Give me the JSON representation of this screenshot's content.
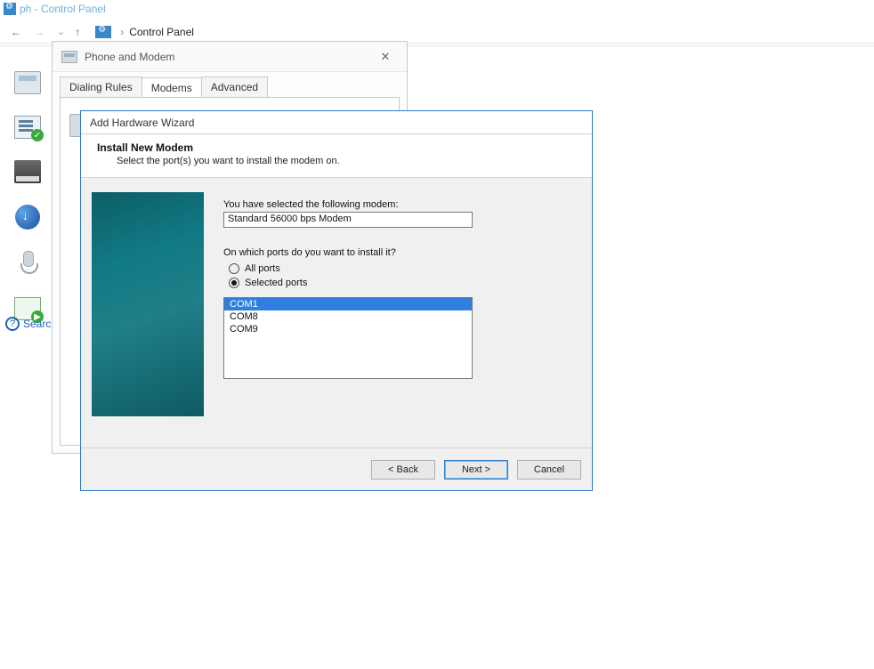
{
  "window": {
    "title": "ph - Control Panel"
  },
  "nav": {
    "breadcrumb": "Control Panel"
  },
  "search": {
    "label": "Searc"
  },
  "phone_dialog": {
    "title": "Phone and Modem",
    "tabs": [
      "Dialing Rules",
      "Modems",
      "Advanced"
    ],
    "active_tab": 1
  },
  "wizard": {
    "title": "Add Hardware Wizard",
    "heading": "Install New Modem",
    "subheading": "Select the port(s) you want to install the modem on.",
    "selected_label": "You have selected the following modem:",
    "selected_modem": "Standard 56000 bps Modem",
    "port_question": "On which ports do you want to install it?",
    "radio_all": "All ports",
    "radio_selected": "Selected ports",
    "radio_choice": "selected",
    "ports": [
      "COM1",
      "COM8",
      "COM9"
    ],
    "port_selected_index": 0,
    "buttons": {
      "back": "< Back",
      "next": "Next >",
      "cancel": "Cancel"
    }
  }
}
